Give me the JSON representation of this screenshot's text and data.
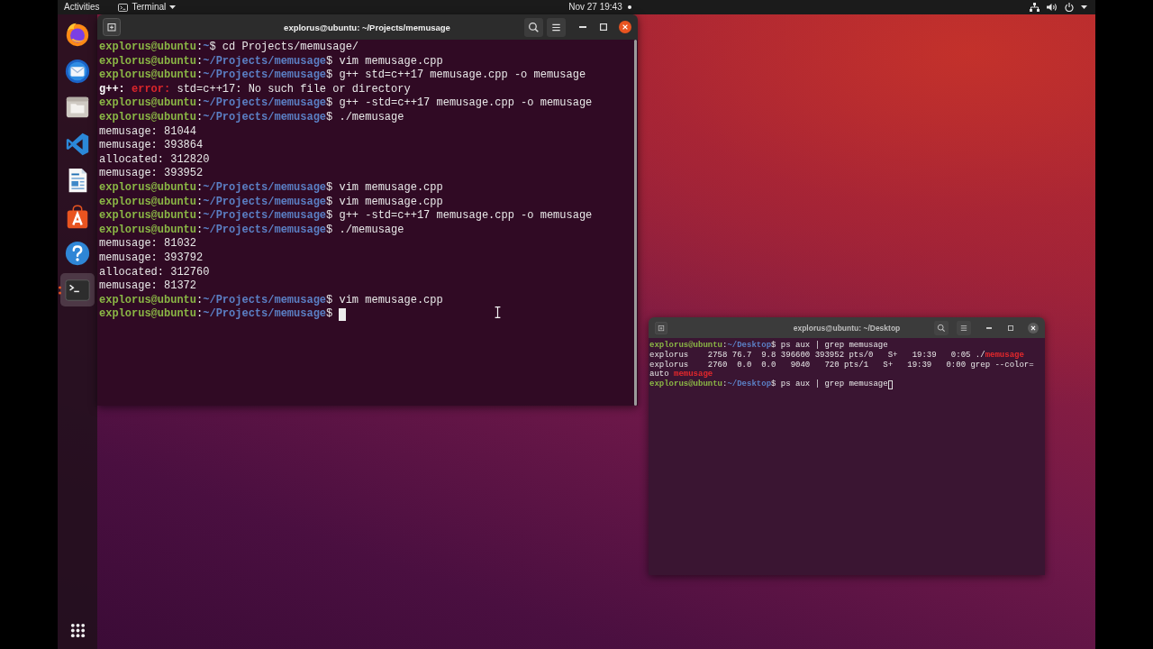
{
  "top_bar": {
    "activities": "Activities",
    "app_menu": "Terminal",
    "clock": "Nov 27 19:43",
    "notification": true,
    "tray": [
      {
        "kind": "network"
      },
      {
        "kind": "volume"
      },
      {
        "kind": "power"
      },
      {
        "kind": "menu"
      }
    ]
  },
  "dock": {
    "items": [
      {
        "kind": "browser",
        "selected": false,
        "running": false
      },
      {
        "kind": "mail",
        "selected": false,
        "running": false
      },
      {
        "kind": "files",
        "selected": false,
        "running": false
      },
      {
        "kind": "code",
        "selected": false,
        "running": false
      },
      {
        "kind": "writer",
        "selected": false,
        "running": false
      },
      {
        "kind": "store",
        "selected": false,
        "running": false
      },
      {
        "kind": "help",
        "selected": false,
        "running": false
      },
      {
        "kind": "terminal",
        "selected": true,
        "running": true
      }
    ]
  },
  "terminals": [
    {
      "title": "explorus@ubuntu: ~/Projects/memusage",
      "focused": true,
      "scrollbar": true,
      "lines": [
        [
          {
            "kind": "user",
            "text": "explorus@ubuntu"
          },
          {
            "kind": "plain",
            "text": ":"
          },
          {
            "kind": "path",
            "text": "~"
          },
          {
            "kind": "plain",
            "text": "$ cd Projects/memusage/"
          }
        ],
        [
          {
            "kind": "user",
            "text": "explorus@ubuntu"
          },
          {
            "kind": "plain",
            "text": ":"
          },
          {
            "kind": "path",
            "text": "~/Projects/memusage"
          },
          {
            "kind": "plain",
            "text": "$ vim memusage.cpp"
          }
        ],
        [
          {
            "kind": "user",
            "text": "explorus@ubuntu"
          },
          {
            "kind": "plain",
            "text": ":"
          },
          {
            "kind": "path",
            "text": "~/Projects/memusage"
          },
          {
            "kind": "plain",
            "text": "$ g++ std=c++17 memusage.cpp -o memusage"
          }
        ],
        [
          {
            "kind": "bold",
            "text": "g++:"
          },
          {
            "kind": "error",
            "text": " error:"
          },
          {
            "kind": "plain",
            "text": " std=c++17: No such file or directory"
          }
        ],
        [
          {
            "kind": "user",
            "text": "explorus@ubuntu"
          },
          {
            "kind": "plain",
            "text": ":"
          },
          {
            "kind": "path",
            "text": "~/Projects/memusage"
          },
          {
            "kind": "plain",
            "text": "$ g++ -std=c++17 memusage.cpp -o memusage"
          }
        ],
        [
          {
            "kind": "user",
            "text": "explorus@ubuntu"
          },
          {
            "kind": "plain",
            "text": ":"
          },
          {
            "kind": "path",
            "text": "~/Projects/memusage"
          },
          {
            "kind": "plain",
            "text": "$ ./memusage"
          }
        ],
        [
          {
            "kind": "plain",
            "text": "memusage: 81044"
          }
        ],
        [
          {
            "kind": "plain",
            "text": "memusage: 393864"
          }
        ],
        [
          {
            "kind": "plain",
            "text": "allocated: 312820"
          }
        ],
        [
          {
            "kind": "plain",
            "text": "memusage: 393952"
          }
        ],
        [
          {
            "kind": "user",
            "text": "explorus@ubuntu"
          },
          {
            "kind": "plain",
            "text": ":"
          },
          {
            "kind": "path",
            "text": "~/Projects/memusage"
          },
          {
            "kind": "plain",
            "text": "$ vim memusage.cpp"
          }
        ],
        [
          {
            "kind": "user",
            "text": "explorus@ubuntu"
          },
          {
            "kind": "plain",
            "text": ":"
          },
          {
            "kind": "path",
            "text": "~/Projects/memusage"
          },
          {
            "kind": "plain",
            "text": "$ vim memusage.cpp"
          }
        ],
        [
          {
            "kind": "user",
            "text": "explorus@ubuntu"
          },
          {
            "kind": "plain",
            "text": ":"
          },
          {
            "kind": "path",
            "text": "~/Projects/memusage"
          },
          {
            "kind": "plain",
            "text": "$ g++ -std=c++17 memusage.cpp -o memusage"
          }
        ],
        [
          {
            "kind": "user",
            "text": "explorus@ubuntu"
          },
          {
            "kind": "plain",
            "text": ":"
          },
          {
            "kind": "path",
            "text": "~/Projects/memusage"
          },
          {
            "kind": "plain",
            "text": "$ ./memusage"
          }
        ],
        [
          {
            "kind": "plain",
            "text": "memusage: 81032"
          }
        ],
        [
          {
            "kind": "plain",
            "text": "memusage: 393792"
          }
        ],
        [
          {
            "kind": "plain",
            "text": "allocated: 312760"
          }
        ],
        [
          {
            "kind": "plain",
            "text": "memusage: 81372"
          }
        ],
        [
          {
            "kind": "user",
            "text": "explorus@ubuntu"
          },
          {
            "kind": "plain",
            "text": ":"
          },
          {
            "kind": "path",
            "text": "~/Projects/memusage"
          },
          {
            "kind": "plain",
            "text": "$ vim memusage.cpp"
          }
        ],
        [
          {
            "kind": "user",
            "text": "explorus@ubuntu"
          },
          {
            "kind": "plain",
            "text": ":"
          },
          {
            "kind": "path",
            "text": "~/Projects/memusage"
          },
          {
            "kind": "plain",
            "text": "$ "
          }
        ]
      ]
    },
    {
      "title": "explorus@ubuntu: ~/Desktop",
      "focused": false,
      "scrollbar": false,
      "lines": [
        [
          {
            "kind": "user",
            "text": "explorus@ubuntu"
          },
          {
            "kind": "plain",
            "text": ":"
          },
          {
            "kind": "path",
            "text": "~/Desktop"
          },
          {
            "kind": "plain",
            "text": "$ ps aux | grep memusage"
          }
        ],
        [
          {
            "kind": "plain",
            "text": "explorus    2758 76.7  9.8 396600 393952 pts/0   S+   19:39   0:05 ./"
          },
          {
            "kind": "match",
            "text": "memusage"
          }
        ],
        [
          {
            "kind": "plain",
            "text": "explorus    2760  0.0  0.0   9040   720 pts/1   S+   19:39   0:00 grep --color="
          }
        ],
        [
          {
            "kind": "plain",
            "text": "auto "
          },
          {
            "kind": "match",
            "text": "memusage"
          }
        ],
        [
          {
            "kind": "user",
            "text": "explorus@ubuntu"
          },
          {
            "kind": "plain",
            "text": ":"
          },
          {
            "kind": "path",
            "text": "~/Desktop"
          },
          {
            "kind": "plain",
            "text": "$ ps aux | grep memusage"
          }
        ]
      ]
    }
  ]
}
